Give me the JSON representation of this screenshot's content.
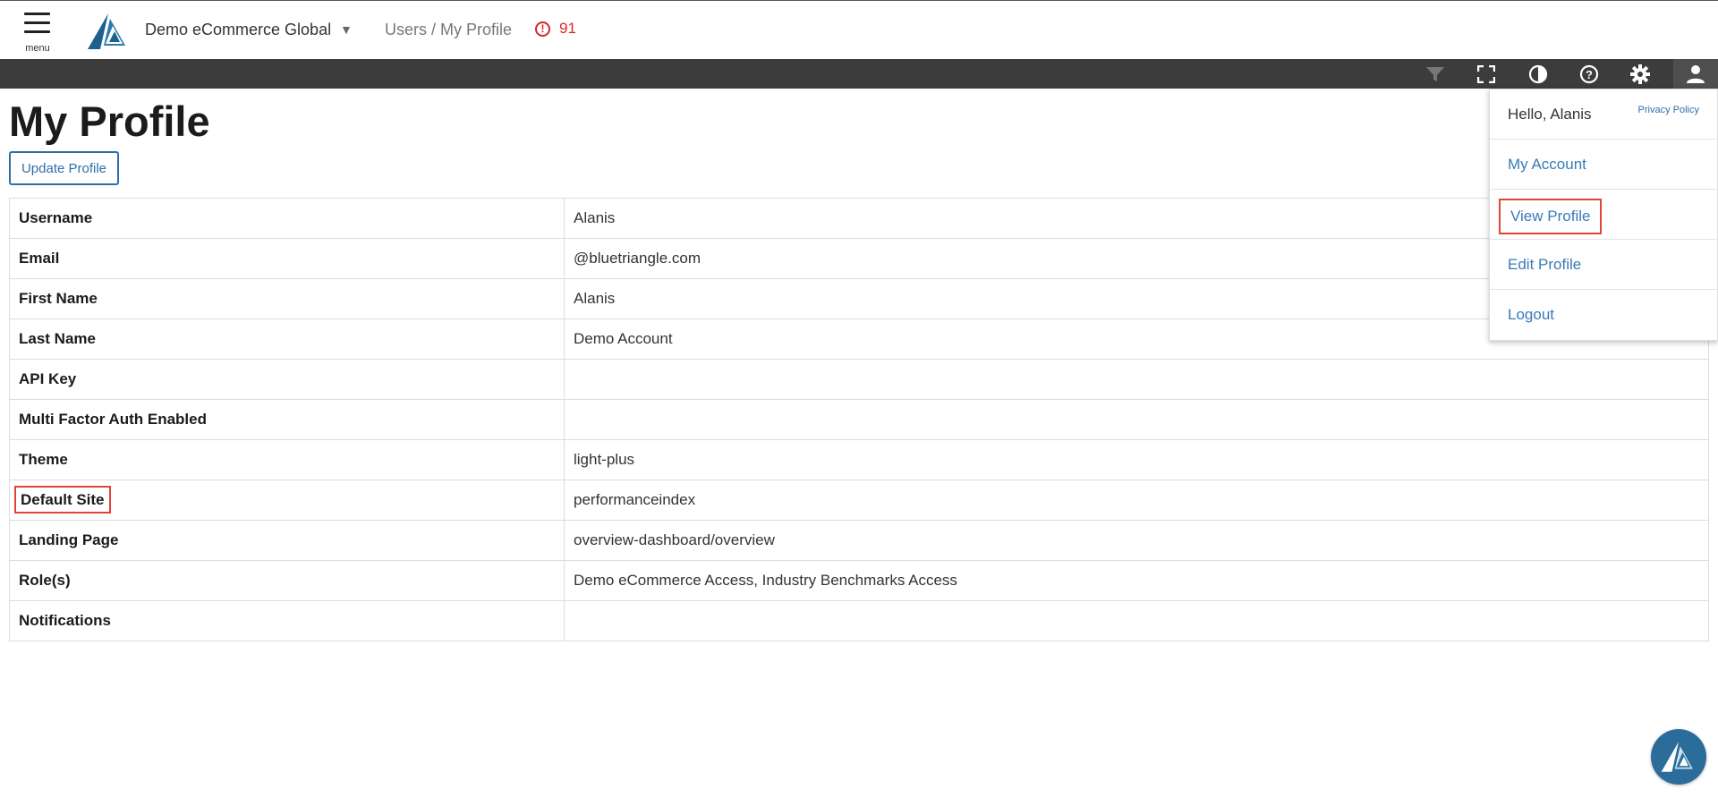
{
  "header": {
    "menu_label": "menu",
    "site_name": "Demo eCommerce Global",
    "breadcrumb": "Users / My Profile",
    "alert_count": "91"
  },
  "toolbar": {
    "icons": [
      "filter-icon",
      "fullscreen-icon",
      "contrast-icon",
      "help-icon",
      "gear-icon",
      "user-icon"
    ]
  },
  "page": {
    "title": "My Profile",
    "update_button": "Update Profile"
  },
  "profile": {
    "rows": [
      {
        "label": "Username",
        "value": "Alanis"
      },
      {
        "label": "Email",
        "value": "@bluetriangle.com"
      },
      {
        "label": "First Name",
        "value": "Alanis"
      },
      {
        "label": "Last Name",
        "value": "Demo Account"
      },
      {
        "label": "API Key",
        "value": ""
      },
      {
        "label": "Multi Factor Auth Enabled",
        "value": ""
      },
      {
        "label": "Theme",
        "value": "light-plus"
      },
      {
        "label": "Default Site",
        "value": "performanceindex"
      },
      {
        "label": "Landing Page",
        "value": "overview-dashboard/overview"
      },
      {
        "label": "Role(s)",
        "value": "Demo eCommerce Access, Industry Benchmarks Access"
      },
      {
        "label": "Notifications",
        "value": ""
      }
    ]
  },
  "user_menu": {
    "greeting": "Hello, Alanis",
    "privacy": "Privacy Policy",
    "items": [
      "My Account",
      "View Profile",
      "Edit Profile",
      "Logout"
    ]
  },
  "colors": {
    "accent": "#2f6fa8",
    "toolbar_bg": "#3c3c3c",
    "alert": "#d62828",
    "highlight": "#e0453a"
  }
}
